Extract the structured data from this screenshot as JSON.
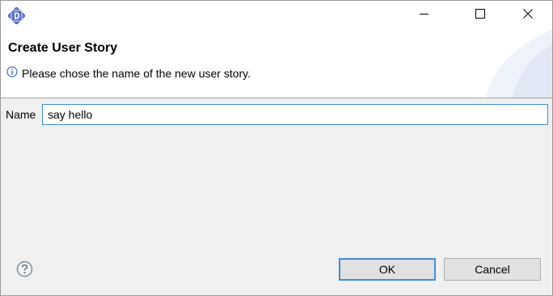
{
  "window": {
    "app_icon": "app-d-logo-icon",
    "controls": [
      "minimize-icon",
      "maximize-icon",
      "close-icon"
    ]
  },
  "header": {
    "title": "Create User Story",
    "message": "Please chose the name of the new user story.",
    "message_icon": "info-icon"
  },
  "form": {
    "name_label": "Name",
    "name_value": "say hello"
  },
  "footer": {
    "help_icon": "help-icon",
    "ok_label": "OK",
    "cancel_label": "Cancel"
  },
  "colors": {
    "accent": "#3c8fd6",
    "app_icon": "#5b6fd0",
    "dialog_bg": "#f0f0f0",
    "button_bg": "#e1e1e1"
  }
}
